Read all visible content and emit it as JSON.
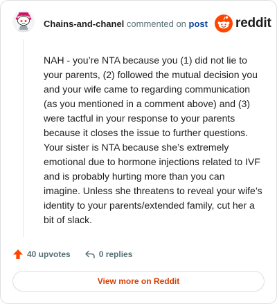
{
  "comment": {
    "author": "Chains-and-chanel",
    "action_text": "commented on",
    "target_link": "post",
    "body": "NAH - you’re NTA because you (1) did not lie to your parents, (2) followed the mutual decision you and your wife came to regarding communication (as you mentioned in a comment above) and (3) were tactful in your response to your parents because it closes the issue to further questions. Your sister is NTA because she’s extremely emotional due to hormone injections related to IVF and is probably hurting more than you can imagine. Unless she threatens to reveal your wife’s identity to your parents/extended family, cut her a bit of slack."
  },
  "brand": {
    "wordmark": "reddit",
    "color": "#ff4500"
  },
  "actions": {
    "upvotes": "40 upvotes",
    "replies": "0 replies",
    "upvote_icon": "upvote-arrow-icon",
    "reply_icon": "reply-arrow-icon"
  },
  "footer": {
    "view_more": "View more on Reddit"
  },
  "colors": {
    "accent": "#d93a00",
    "link": "#0a449b",
    "muted": "#576f76"
  }
}
